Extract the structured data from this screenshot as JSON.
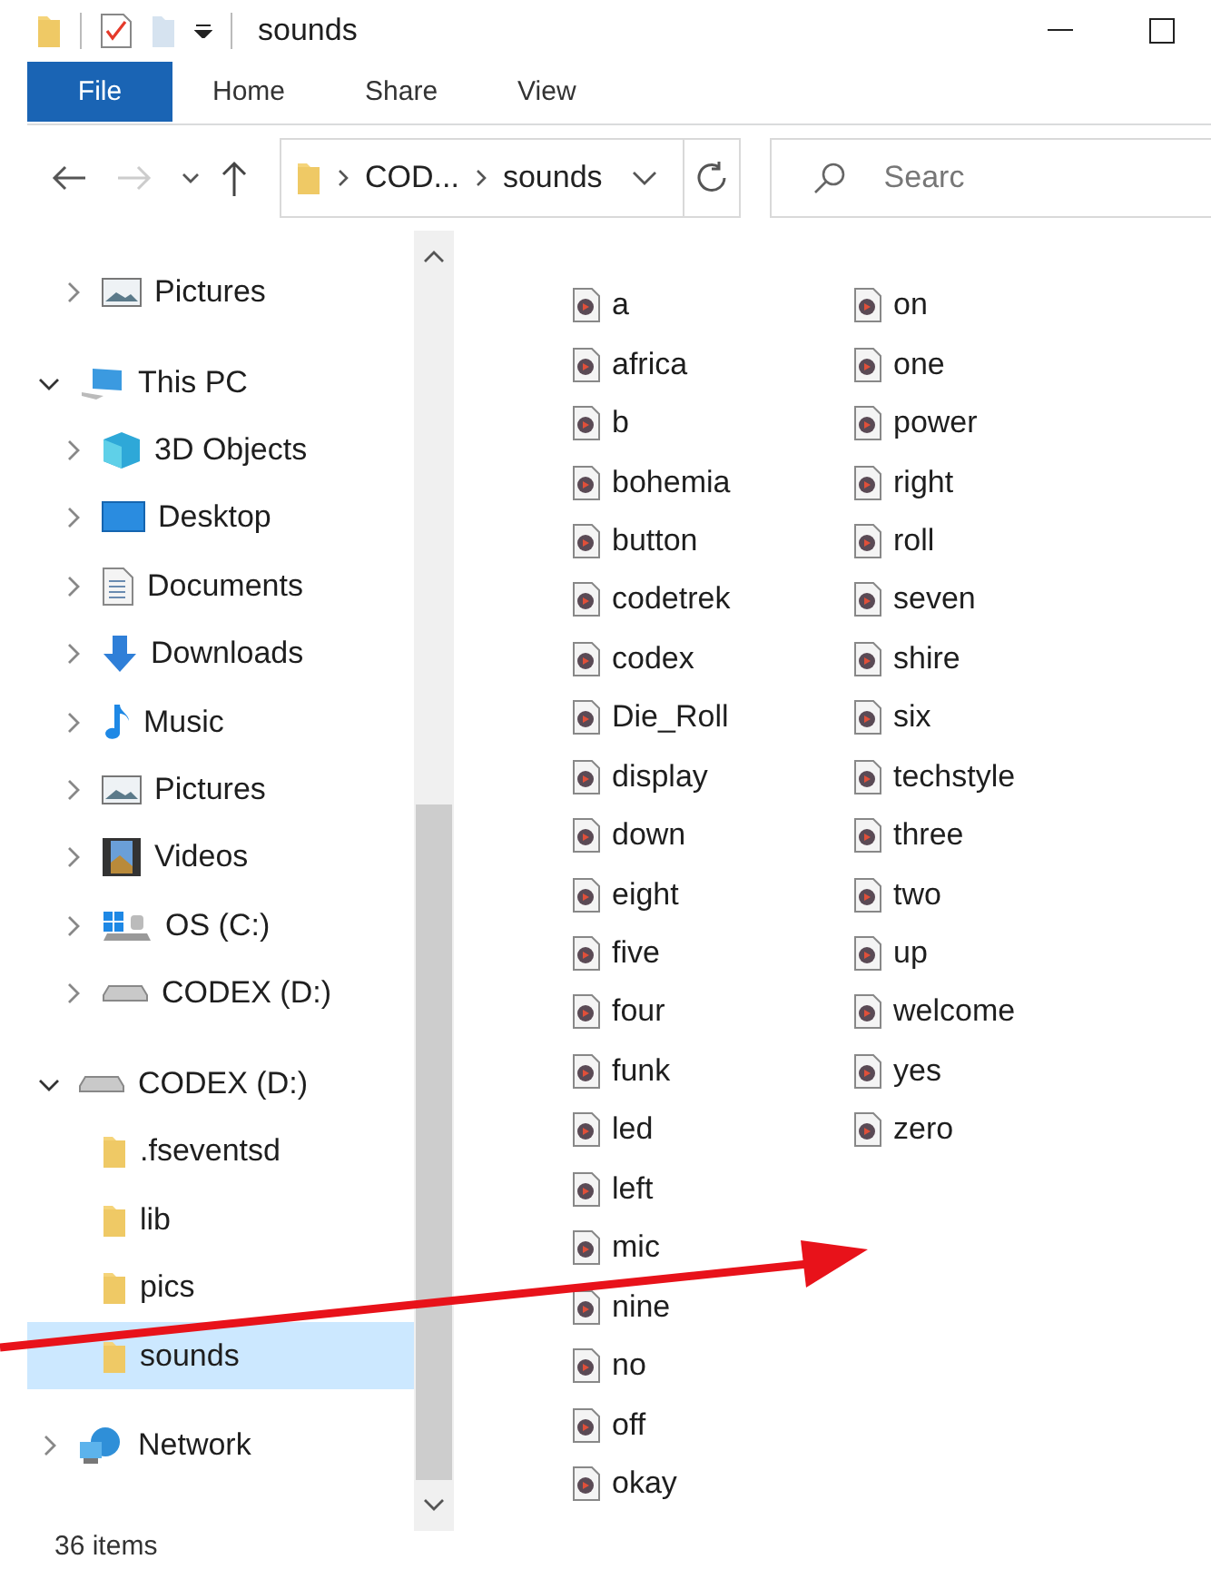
{
  "title_bar": {
    "title": "sounds"
  },
  "ribbon": {
    "tabs": [
      {
        "label": "File",
        "selected": true
      },
      {
        "label": "Home",
        "selected": false
      },
      {
        "label": "Share",
        "selected": false
      },
      {
        "label": "View",
        "selected": false
      }
    ]
  },
  "address_bar": {
    "back_disabled": false,
    "forward_disabled": true,
    "breadcrumbs": [
      "COD...",
      "sounds"
    ],
    "search": {
      "placeholder": "Searc"
    }
  },
  "navigation": {
    "items": [
      {
        "children": [
          {
            "label": "Pictures",
            "kind": "pictures",
            "expanded": false,
            "selected": false
          }
        ]
      },
      {
        "label": "This PC",
        "kind": "pc",
        "expanded": true,
        "selected": false,
        "children": [
          {
            "label": "3D Objects",
            "kind": "cube",
            "expanded": false,
            "selected": false
          },
          {
            "label": "Desktop",
            "kind": "desktop",
            "expanded": false,
            "selected": false
          },
          {
            "label": "Documents",
            "kind": "documents",
            "expanded": false,
            "selected": false
          },
          {
            "label": "Downloads",
            "kind": "downloads",
            "expanded": false,
            "selected": false
          },
          {
            "label": "Music",
            "kind": "music",
            "expanded": false,
            "selected": false
          },
          {
            "label": "Pictures",
            "kind": "pictures",
            "expanded": false,
            "selected": false
          },
          {
            "label": "Videos",
            "kind": "videos",
            "expanded": false,
            "selected": false
          },
          {
            "label": "OS (C:)",
            "kind": "osdrive",
            "expanded": false,
            "selected": false
          },
          {
            "label": "CODEX (D:)",
            "kind": "drive",
            "expanded": false,
            "selected": false
          }
        ]
      },
      {
        "label": "CODEX (D:)",
        "kind": "drive",
        "expanded": true,
        "selected": false,
        "children": [
          {
            "label": ".fseventsd",
            "kind": "folder",
            "selected": false
          },
          {
            "label": "lib",
            "kind": "folder",
            "selected": false
          },
          {
            "label": "pics",
            "kind": "folder",
            "selected": false
          },
          {
            "label": "sounds",
            "kind": "folder",
            "selected": true
          }
        ]
      },
      {
        "label": "Network",
        "kind": "network",
        "expanded": false,
        "selected": false
      }
    ]
  },
  "files": [
    "a",
    "africa",
    "b",
    "bohemia",
    "button",
    "codetrek",
    "codex",
    "Die_Roll",
    "display",
    "down",
    "eight",
    "five",
    "four",
    "funk",
    "led",
    "left",
    "mic",
    "nine",
    "no",
    "off",
    "okay",
    "on",
    "one",
    "power",
    "right",
    "roll",
    "seven",
    "shire",
    "six",
    "techstyle",
    "three",
    "two",
    "up",
    "welcome",
    "yes",
    "zero"
  ],
  "status_bar": {
    "item_count": "36 items"
  }
}
